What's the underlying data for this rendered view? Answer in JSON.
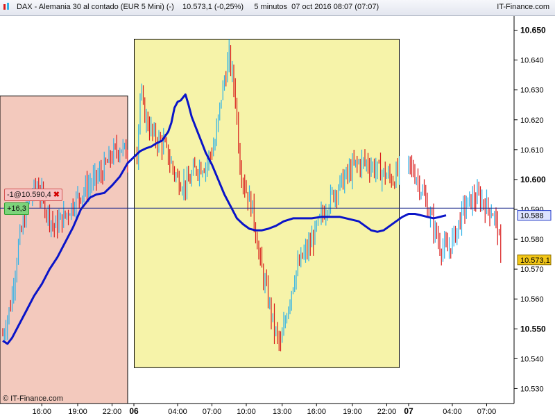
{
  "header": {
    "title": "DAX - Alemania 30 al contado (EUR 5 Mini) (-)    10.573,1 (-0,25%)     5 minutos  07 oct 2016 08:07 (07:07)",
    "brand": "IT-Finance.com"
  },
  "order": {
    "label": "-1@10.590,4",
    "close_glyph": "✖"
  },
  "pnl": {
    "label": "+16,3"
  },
  "footer": {
    "copyright": "© IT-Finance.com"
  },
  "colors": {
    "session1_bg": "#f3c9bd",
    "session2_bg": "#f6f3a9",
    "up_candle": "#2fb2e8",
    "down_candle": "#d81a1a",
    "moving_average": "#0a14c8",
    "order_line": "#1c2a8c",
    "order_pill_bg": "#f6c3c3",
    "pnl_pill_bg": "#7cd47a",
    "ma_tag_bg": "#dde3ff",
    "price_tag_bg": "#f2c617"
  },
  "chart_data": {
    "type": "candlestick",
    "instrument": "DAX - Alemania 30 al contado (EUR 5 Mini)",
    "timeframe": "5 minutos",
    "y_axis": {
      "min": 10.525,
      "max": 10.655,
      "tick_labels": [
        "10.650",
        "10.640",
        "10.630",
        "10.620",
        "10.610",
        "10.600",
        "10.590",
        "10.580",
        "10.570",
        "10.560",
        "10.550",
        "10.540",
        "10.530"
      ],
      "bold_labels": [
        "10.650",
        "10.600",
        "10.550"
      ]
    },
    "x_axis": {
      "tick_labels": [
        {
          "label": "16:00",
          "bar": 25,
          "bold": false
        },
        {
          "label": "19:00",
          "bar": 48,
          "bold": false
        },
        {
          "label": "22:00",
          "bar": 70,
          "bold": false
        },
        {
          "label": "06",
          "bar": 84,
          "bold": true
        },
        {
          "label": "04:00",
          "bar": 112,
          "bold": false
        },
        {
          "label": "07:00",
          "bar": 134,
          "bold": false
        },
        {
          "label": "10:00",
          "bar": 156,
          "bold": false
        },
        {
          "label": "13:00",
          "bar": 179,
          "bold": false
        },
        {
          "label": "16:00",
          "bar": 201,
          "bold": false
        },
        {
          "label": "19:00",
          "bar": 224,
          "bold": false
        },
        {
          "label": "22:00",
          "bar": 246,
          "bold": false
        },
        {
          "label": "07",
          "bar": 260,
          "bold": true
        },
        {
          "label": "04:00",
          "bar": 288,
          "bold": false
        },
        {
          "label": "07:00",
          "bar": 310,
          "bold": false
        }
      ]
    },
    "session_ranges": [
      {
        "name": "session-1",
        "from_bar": 0,
        "to_bar": 80,
        "y_top": 10.628,
        "y_bottom": 10.525
      },
      {
        "name": "session-2",
        "from_bar": 86,
        "to_bar": 254,
        "y_top": 10.647,
        "y_bottom": 10.537
      }
    ],
    "order_level": 10.5904,
    "current_price": {
      "value": 10.5731,
      "label": "10.573,1"
    },
    "moving_average_last": {
      "value": 10.588,
      "label": "10.588"
    },
    "series": [
      {
        "kind": "candles",
        "count": 320,
        "anchors": [
          [
            0,
            10.548
          ],
          [
            5,
            10.558
          ],
          [
            10,
            10.578
          ],
          [
            16,
            10.592
          ],
          [
            22,
            10.598
          ],
          [
            28,
            10.59
          ],
          [
            33,
            10.584
          ],
          [
            40,
            10.588
          ],
          [
            48,
            10.594
          ],
          [
            55,
            10.598
          ],
          [
            63,
            10.602
          ],
          [
            71,
            10.609
          ],
          [
            76,
            10.611
          ],
          [
            80,
            10.608
          ],
          [
            86,
            10.609
          ],
          [
            88,
            10.628
          ],
          [
            92,
            10.62
          ],
          [
            97,
            10.614
          ],
          [
            103,
            10.612
          ],
          [
            108,
            10.605
          ],
          [
            112,
            10.6
          ],
          [
            118,
            10.598
          ],
          [
            124,
            10.604
          ],
          [
            130,
            10.605
          ],
          [
            136,
            10.612
          ],
          [
            140,
            10.628
          ],
          [
            145,
            10.641
          ],
          [
            149,
            10.628
          ],
          [
            152,
            10.605
          ],
          [
            155,
            10.598
          ],
          [
            160,
            10.59
          ],
          [
            165,
            10.572
          ],
          [
            170,
            10.56
          ],
          [
            174,
            10.55
          ],
          [
            178,
            10.544
          ],
          [
            182,
            10.556
          ],
          [
            187,
            10.568
          ],
          [
            192,
            10.574
          ],
          [
            197,
            10.578
          ],
          [
            202,
            10.585
          ],
          [
            208,
            10.592
          ],
          [
            214,
            10.597
          ],
          [
            220,
            10.601
          ],
          [
            226,
            10.605
          ],
          [
            232,
            10.606
          ],
          [
            238,
            10.604
          ],
          [
            244,
            10.602
          ],
          [
            250,
            10.6
          ],
          [
            254,
            10.603
          ],
          [
            260,
            10.605
          ],
          [
            265,
            10.601
          ],
          [
            270,
            10.594
          ],
          [
            275,
            10.586
          ],
          [
            280,
            10.578
          ],
          [
            285,
            10.576
          ],
          [
            290,
            10.582
          ],
          [
            295,
            10.59
          ],
          [
            300,
            10.593
          ],
          [
            305,
            10.594
          ],
          [
            310,
            10.591
          ],
          [
            314,
            10.589
          ],
          [
            317,
            10.584
          ],
          [
            319,
            10.573
          ]
        ]
      },
      {
        "kind": "moving_average",
        "name": "",
        "points": [
          [
            0,
            10.546
          ],
          [
            3,
            10.545
          ],
          [
            6,
            10.547
          ],
          [
            10,
            10.551
          ],
          [
            15,
            10.556
          ],
          [
            20,
            10.561
          ],
          [
            25,
            10.565
          ],
          [
            30,
            10.57
          ],
          [
            35,
            10.574
          ],
          [
            40,
            10.579
          ],
          [
            45,
            10.584
          ],
          [
            50,
            10.59
          ],
          [
            56,
            10.594
          ],
          [
            60,
            10.595
          ],
          [
            65,
            10.5955
          ],
          [
            70,
            10.598
          ],
          [
            75,
            10.601
          ],
          [
            80,
            10.6055
          ],
          [
            84,
            10.6075
          ],
          [
            88,
            10.6095
          ],
          [
            92,
            10.6105
          ],
          [
            95,
            10.611
          ],
          [
            98,
            10.612
          ],
          [
            102,
            10.613
          ],
          [
            106,
            10.616
          ],
          [
            108,
            10.619
          ],
          [
            110,
            10.624
          ],
          [
            112,
            10.626
          ],
          [
            114,
            10.6265
          ],
          [
            117,
            10.6285
          ],
          [
            119,
            10.625
          ],
          [
            121,
            10.621
          ],
          [
            124,
            10.617
          ],
          [
            127,
            10.613
          ],
          [
            130,
            10.609
          ],
          [
            134,
            10.605
          ],
          [
            138,
            10.6
          ],
          [
            142,
            10.595
          ],
          [
            146,
            10.591
          ],
          [
            150,
            10.587
          ],
          [
            154,
            10.585
          ],
          [
            158,
            10.5835
          ],
          [
            162,
            10.583
          ],
          [
            166,
            10.583
          ],
          [
            170,
            10.5835
          ],
          [
            175,
            10.5845
          ],
          [
            180,
            10.586
          ],
          [
            186,
            10.587
          ],
          [
            192,
            10.587
          ],
          [
            198,
            10.587
          ],
          [
            204,
            10.5875
          ],
          [
            210,
            10.5875
          ],
          [
            216,
            10.5875
          ],
          [
            220,
            10.587
          ],
          [
            224,
            10.5865
          ],
          [
            228,
            10.586
          ],
          [
            232,
            10.5845
          ],
          [
            236,
            10.583
          ],
          [
            240,
            10.5825
          ],
          [
            244,
            10.583
          ],
          [
            248,
            10.5845
          ],
          [
            252,
            10.586
          ],
          [
            256,
            10.5875
          ],
          [
            260,
            10.5885
          ],
          [
            264,
            10.5885
          ],
          [
            268,
            10.588
          ],
          [
            272,
            10.5875
          ],
          [
            276,
            10.587
          ],
          [
            280,
            10.5875
          ],
          [
            284,
            10.588
          ]
        ]
      }
    ]
  }
}
